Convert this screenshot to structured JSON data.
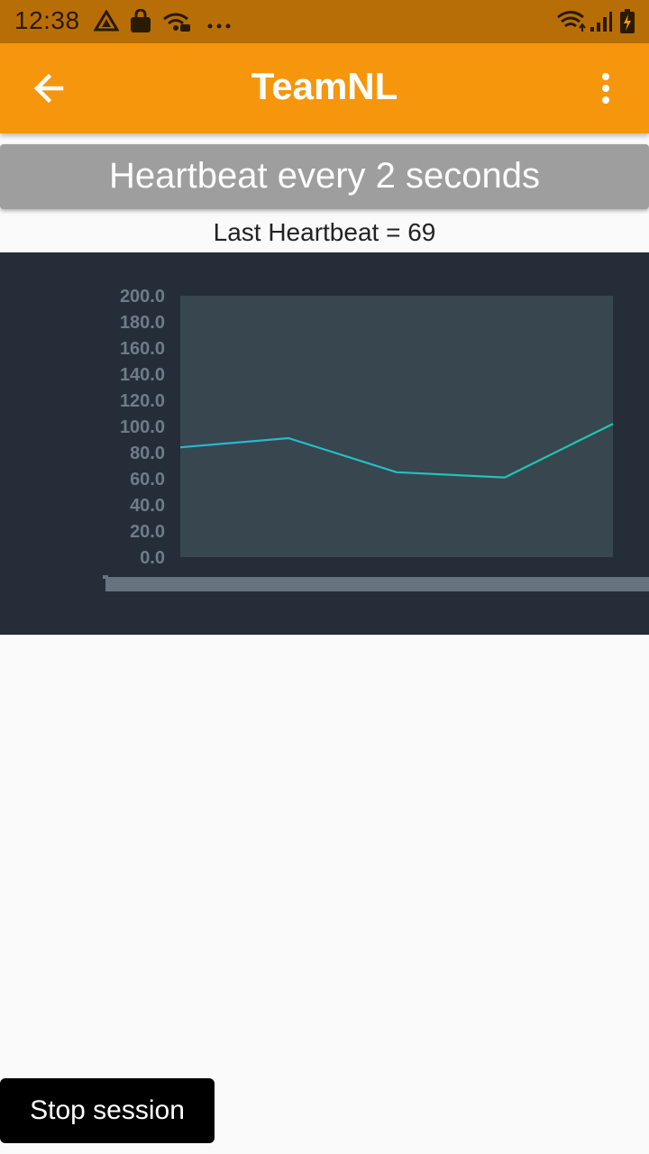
{
  "status_bar": {
    "time": "12:38",
    "icons": [
      "drive-icon",
      "shopping-bag-icon",
      "wifi-chat-icon",
      "more-dots-icon",
      "wifi-icon",
      "signal-icon",
      "battery-charging-icon"
    ]
  },
  "app_bar": {
    "title": "TeamNL",
    "back_icon": "arrow-back-icon",
    "menu_icon": "more-vert-icon"
  },
  "banner": {
    "text": "Heartbeat every 2 seconds"
  },
  "last_heartbeat": {
    "text": "Last Heartbeat = 69"
  },
  "colors": {
    "status_bar": "#b86e06",
    "app_bar": "#f5960c",
    "banner": "#9e9e9e",
    "chart_bg": "#242d38",
    "plot_bg": "#37464f",
    "line_start": "#29b6d8",
    "line_end": "#1ec9a8"
  },
  "chart_data": {
    "type": "line",
    "ytick_labels": [
      "200.0",
      "180.0",
      "160.0",
      "140.0",
      "120.0",
      "100.0",
      "80.0",
      "60.0",
      "40.0",
      "20.0",
      "0.0"
    ],
    "ylim": [
      0,
      200
    ],
    "x": [
      0,
      1,
      2,
      3,
      4
    ],
    "series": [
      {
        "values": [
          84,
          91,
          65,
          61,
          102
        ]
      }
    ],
    "grid": false,
    "scrollbar": true
  },
  "actions": {
    "stop_label": "Stop session"
  }
}
